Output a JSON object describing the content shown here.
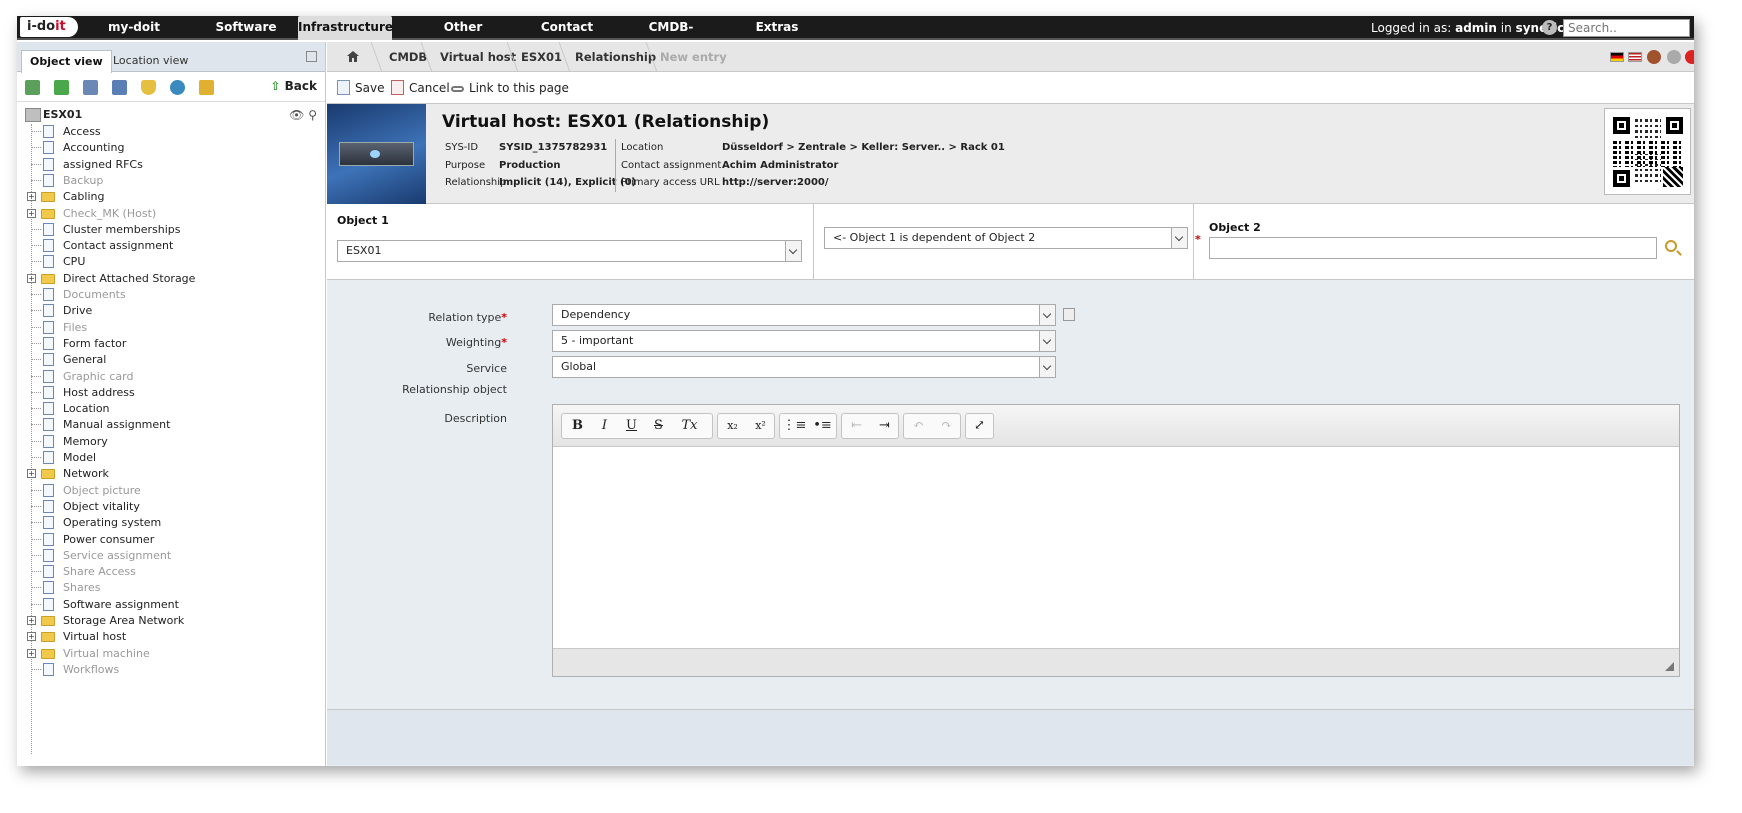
{
  "nav": {
    "logo": "i-doit",
    "items": [
      "my-doit",
      "Software",
      "Infrastructure",
      "Other",
      "Contact",
      "CMDB-Explorer",
      "Extras"
    ],
    "logged_prefix": "Logged in as:",
    "user": "admin",
    "in_word": "in",
    "tenant": "synetics",
    "search_placeholder": "Search.."
  },
  "left": {
    "tabs": [
      "Object view",
      "Location view"
    ],
    "back_label": "Back",
    "root": "ESX01",
    "tree": [
      {
        "label": "Access",
        "type": "doc",
        "dim": false
      },
      {
        "label": "Accounting",
        "type": "doc",
        "dim": false
      },
      {
        "label": "assigned RFCs",
        "type": "doc",
        "dim": false
      },
      {
        "label": "Backup",
        "type": "doc",
        "dim": true
      },
      {
        "label": "Cabling",
        "type": "folder",
        "dim": false
      },
      {
        "label": "Check_MK (Host)",
        "type": "folder",
        "dim": true
      },
      {
        "label": "Cluster memberships",
        "type": "doc",
        "dim": false
      },
      {
        "label": "Contact assignment",
        "type": "doc",
        "dim": false
      },
      {
        "label": "CPU",
        "type": "doc",
        "dim": false
      },
      {
        "label": "Direct Attached Storage",
        "type": "folder",
        "dim": false
      },
      {
        "label": "Documents",
        "type": "doc",
        "dim": true
      },
      {
        "label": "Drive",
        "type": "doc",
        "dim": false
      },
      {
        "label": "Files",
        "type": "doc",
        "dim": true
      },
      {
        "label": "Form factor",
        "type": "doc",
        "dim": false
      },
      {
        "label": "General",
        "type": "doc",
        "dim": false
      },
      {
        "label": "Graphic card",
        "type": "doc",
        "dim": true
      },
      {
        "label": "Host address",
        "type": "doc",
        "dim": false
      },
      {
        "label": "Location",
        "type": "doc",
        "dim": false
      },
      {
        "label": "Manual assignment",
        "type": "doc",
        "dim": false
      },
      {
        "label": "Memory",
        "type": "doc",
        "dim": false
      },
      {
        "label": "Model",
        "type": "doc",
        "dim": false
      },
      {
        "label": "Network",
        "type": "folder",
        "dim": false
      },
      {
        "label": "Object picture",
        "type": "doc",
        "dim": true
      },
      {
        "label": "Object vitality",
        "type": "doc",
        "dim": false
      },
      {
        "label": "Operating system",
        "type": "doc",
        "dim": false
      },
      {
        "label": "Power consumer",
        "type": "doc",
        "dim": false
      },
      {
        "label": "Service assignment",
        "type": "doc",
        "dim": true
      },
      {
        "label": "Share Access",
        "type": "doc",
        "dim": true
      },
      {
        "label": "Shares",
        "type": "doc",
        "dim": true
      },
      {
        "label": "Software assignment",
        "type": "doc",
        "dim": false
      },
      {
        "label": "Storage Area Network",
        "type": "folder",
        "dim": false
      },
      {
        "label": "Virtual host",
        "type": "folder",
        "dim": false
      },
      {
        "label": "Virtual machine",
        "type": "folder",
        "dim": true
      },
      {
        "label": "Workflows",
        "type": "doc",
        "dim": true
      }
    ]
  },
  "breadcrumb": [
    "CMDB",
    "Virtual host",
    "ESX01",
    "Relationship",
    "New entry"
  ],
  "toolbar": {
    "save": "Save",
    "cancel": "Cancel",
    "link": "Link to this page"
  },
  "object": {
    "title": "Virtual host: ESX01 (Relationship)",
    "sysid_label": "SYS-ID",
    "sysid": "SYSID_1375782931",
    "purpose_label": "Purpose",
    "purpose": "Production",
    "relationship_label": "Relationship",
    "relationship": "Implicit (14), Explicit (0)",
    "location_label": "Location",
    "location": "Düsseldorf > Zentrale > Keller: Server.. > Rack 01",
    "contact_label": "Contact assignment",
    "contact": "Achim Administrator",
    "url_label": "Primary access URL",
    "url": "http://server:2000/"
  },
  "relation": {
    "object1_label": "Object 1",
    "object1_value": "ESX01",
    "direction_value": "<- Object 1 is dependent of Object 2",
    "object2_label": "Object 2",
    "object2_value": ""
  },
  "form": {
    "relation_type_label": "Relation type",
    "relation_type": "Dependency",
    "weighting_label": "Weighting",
    "weighting": "5 - important",
    "service_label": "Service",
    "service": "Global",
    "relationship_object_label": "Relationship object",
    "description_label": "Description"
  },
  "editor_buttons": [
    "B",
    "I",
    "U",
    "S",
    "Tx",
    "x₂",
    "x²"
  ]
}
